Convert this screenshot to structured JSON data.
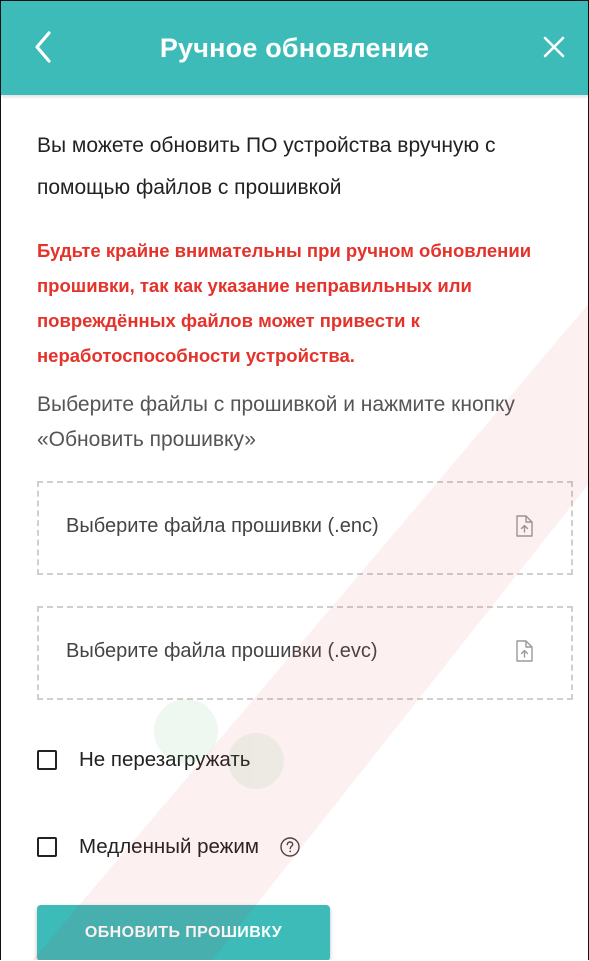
{
  "header": {
    "title": "Ручное обновление",
    "back_icon": "chevron-left-icon",
    "close_icon": "close-icon",
    "accent_color": "#3dbbb8"
  },
  "intro_text": "Вы можете обновить ПО устройства вручную с помощью файлов с прошивкой",
  "warning_text": "Будьте крайне внимательны при ручном обновлении прошивки, так как указание неправильных или повреждённых файлов может привести к неработоспособности устройства.",
  "warning_color": "#e5322b",
  "instructions_text": "Выберите файлы с прошивкой и нажмите кнопку «Обновить прошивку»",
  "file_inputs": [
    {
      "placeholder": "Выберите файла прошивки (.enc)",
      "icon": "file-upload-icon"
    },
    {
      "placeholder": "Выберите файла прошивки (.evc)",
      "icon": "file-upload-icon"
    }
  ],
  "options": {
    "no_reboot": {
      "label": "Не перезагружать",
      "checked": false
    },
    "slow_mode": {
      "label": "Медленный режим",
      "checked": false,
      "help_icon": "help-circle-icon"
    }
  },
  "update_button_label": "ОБНОВИТЬ ПРОШИВКУ"
}
